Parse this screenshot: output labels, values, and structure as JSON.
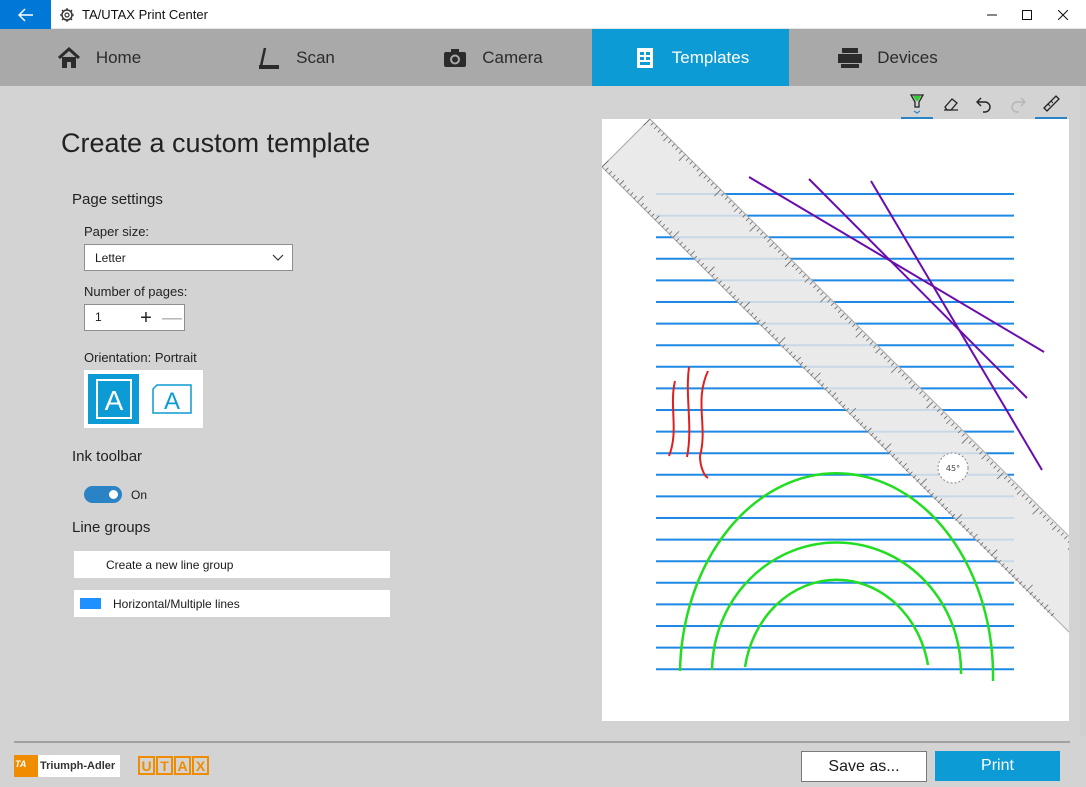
{
  "window": {
    "title": "TA/UTAX Print Center",
    "accent": "#0c9bd4",
    "controls": [
      "minimize",
      "maximize",
      "close"
    ]
  },
  "nav": {
    "tabs": [
      {
        "label": "Home",
        "icon": "home-icon"
      },
      {
        "label": "Scan",
        "icon": "scan-icon"
      },
      {
        "label": "Camera",
        "icon": "camera-icon"
      },
      {
        "label": "Templates",
        "icon": "templates-icon",
        "active": true
      },
      {
        "label": "Devices",
        "icon": "printer-icon"
      }
    ]
  },
  "main": {
    "title": "Create a custom template",
    "page_settings": {
      "heading": "Page settings",
      "paper_size_label": "Paper size:",
      "paper_size_value": "Letter",
      "pages_label": "Number of pages:",
      "pages_value": "1",
      "plus": "+",
      "minus": "—",
      "orientation_label": "Orientation:  Portrait",
      "orientation_selected": "portrait",
      "orient_glyph": "A"
    },
    "ink_toolbar": {
      "heading": "Ink toolbar",
      "toggle_label": "On",
      "toggle_on": true
    },
    "line_groups": {
      "heading": "Line groups",
      "new_button": "Create a new line group",
      "items": [
        {
          "label": "Horizontal/Multiple lines",
          "color": "#1e90ff"
        }
      ]
    }
  },
  "ink_tools": [
    "pen-icon",
    "eraser-icon",
    "undo-icon",
    "redo-icon",
    "ruler-icon"
  ],
  "canvas": {
    "ruler_angle_label": "45°",
    "line_color": "#1e88e5",
    "ink_colors": {
      "purple": "#6a0dad",
      "red": "#e02020",
      "green": "#22dd22"
    }
  },
  "footer": {
    "brand_ta": "Triumph-Adler",
    "brand_ta_mark": "TA",
    "brand_utax": [
      "U",
      "T",
      "A",
      "X"
    ],
    "save_label": "Save as...",
    "print_label": "Print"
  }
}
